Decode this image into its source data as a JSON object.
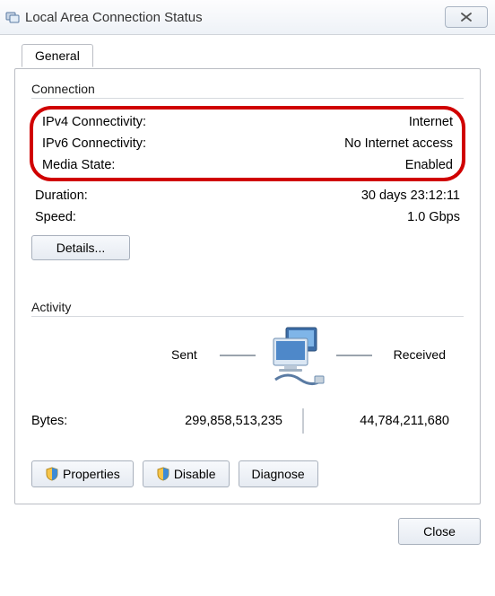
{
  "window": {
    "title": "Local Area Connection Status"
  },
  "tab": {
    "general": "General"
  },
  "connection": {
    "heading": "Connection",
    "ipv4_label": "IPv4 Connectivity:",
    "ipv4_value": "Internet",
    "ipv6_label": "IPv6 Connectivity:",
    "ipv6_value": "No Internet access",
    "media_label": "Media State:",
    "media_value": "Enabled",
    "duration_label": "Duration:",
    "duration_value": "30 days 23:12:11",
    "speed_label": "Speed:",
    "speed_value": "1.0 Gbps",
    "details_button": "Details..."
  },
  "activity": {
    "heading": "Activity",
    "sent_label": "Sent",
    "received_label": "Received",
    "bytes_label": "Bytes:",
    "bytes_sent": "299,858,513,235",
    "bytes_received": "44,784,211,680"
  },
  "buttons": {
    "properties": "Properties",
    "disable": "Disable",
    "diagnose": "Diagnose",
    "close": "Close"
  }
}
